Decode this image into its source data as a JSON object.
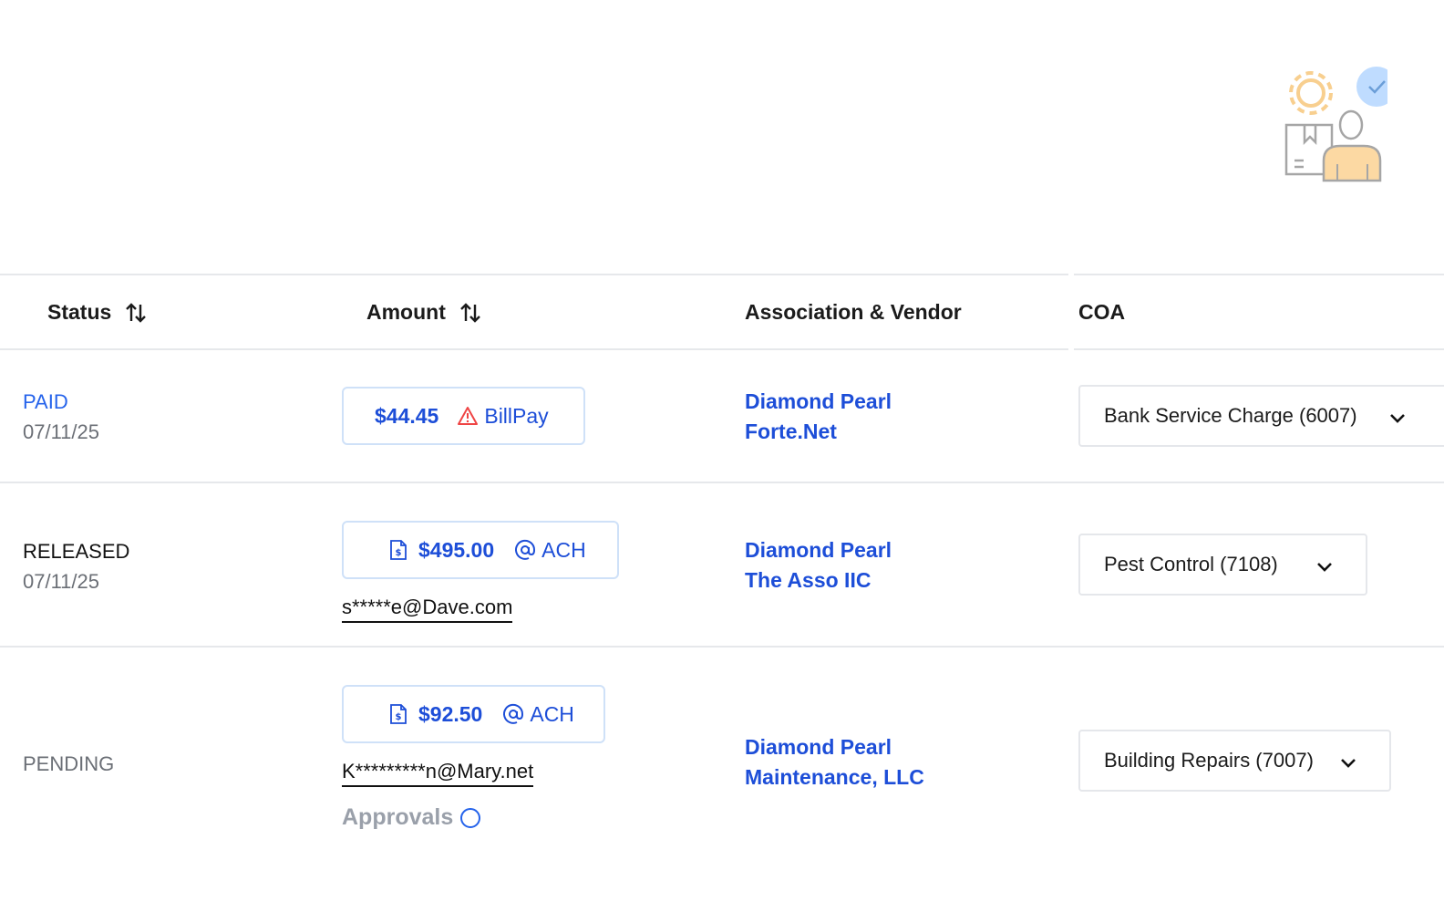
{
  "illustration": {
    "icon": "vendor-approval-illustration-icon",
    "accent": "#fbd9a6",
    "badge_color": "#bfdcff"
  },
  "table": {
    "columns": [
      {
        "label": "Status",
        "sortable": true
      },
      {
        "label": "Amount",
        "sortable": true
      },
      {
        "label": "Association & Vendor",
        "sortable": false
      },
      {
        "label": "COA",
        "sortable": false
      }
    ],
    "rows": [
      {
        "status": "PAID",
        "date": "07/11/25",
        "amount": "$44.45",
        "method": "BillPay",
        "method_icon": "warning-icon",
        "email": "",
        "association": "Diamond Pearl",
        "vendor": "Forte.Net",
        "coa": "Bank Service Charge (6007)"
      },
      {
        "status": "RELEASED",
        "date": "07/11/25",
        "amount": "$495.00",
        "method": "ACH",
        "method_icon": "at-icon",
        "email": "s*****e@Dave.com",
        "association": "Diamond Pearl",
        "vendor": "The Asso IIC",
        "coa": "Pest Control (7108)"
      },
      {
        "status": "PENDING",
        "date": "",
        "amount": "$92.50",
        "method": "ACH",
        "method_icon": "at-icon",
        "email": "K*********n@Mary.net",
        "approvals": "Approvals",
        "association": "Diamond Pearl",
        "vendor": "Maintenance, LLC",
        "coa": "Building Repairs (7007)"
      }
    ]
  },
  "colors": {
    "link_blue": "#1d4ed8",
    "paid_blue": "#2563eb",
    "warning_red": "#ef4444",
    "border": "#e6e8eb"
  }
}
